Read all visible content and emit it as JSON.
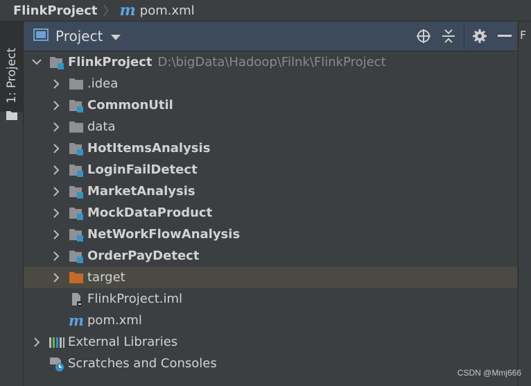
{
  "breadcrumb": {
    "project": "FlinkProject",
    "file_icon": "m",
    "file": "pom.xml"
  },
  "left_strip": {
    "tab_label": "1: Project"
  },
  "panel": {
    "view_label": "Project"
  },
  "tree": {
    "root": {
      "name": "FlinkProject",
      "path": "D:\\bigData\\Hadoop\\Filnk\\FlinkProject"
    },
    "children": [
      {
        "name": ".idea"
      },
      {
        "name": "CommonUtil"
      },
      {
        "name": "data"
      },
      {
        "name": "HotItemsAnalysis"
      },
      {
        "name": "LoginFailDetect"
      },
      {
        "name": "MarketAnalysis"
      },
      {
        "name": "MockDataProduct"
      },
      {
        "name": "NetWorkFlowAnalysis"
      },
      {
        "name": "OrderPayDetect"
      },
      {
        "name": "target"
      },
      {
        "name": "FlinkProject.iml"
      },
      {
        "name": "pom.xml",
        "icon_letter": "m"
      }
    ],
    "external_libraries": "External Libraries",
    "scratches": "Scratches and Consoles"
  },
  "right_strip": {
    "peek": "F"
  },
  "watermark": "CSDN @Mmj666",
  "colors": {
    "module_accent": "#3592c4",
    "target_folder": "#c46b2a",
    "selection": "#4b4a42"
  }
}
